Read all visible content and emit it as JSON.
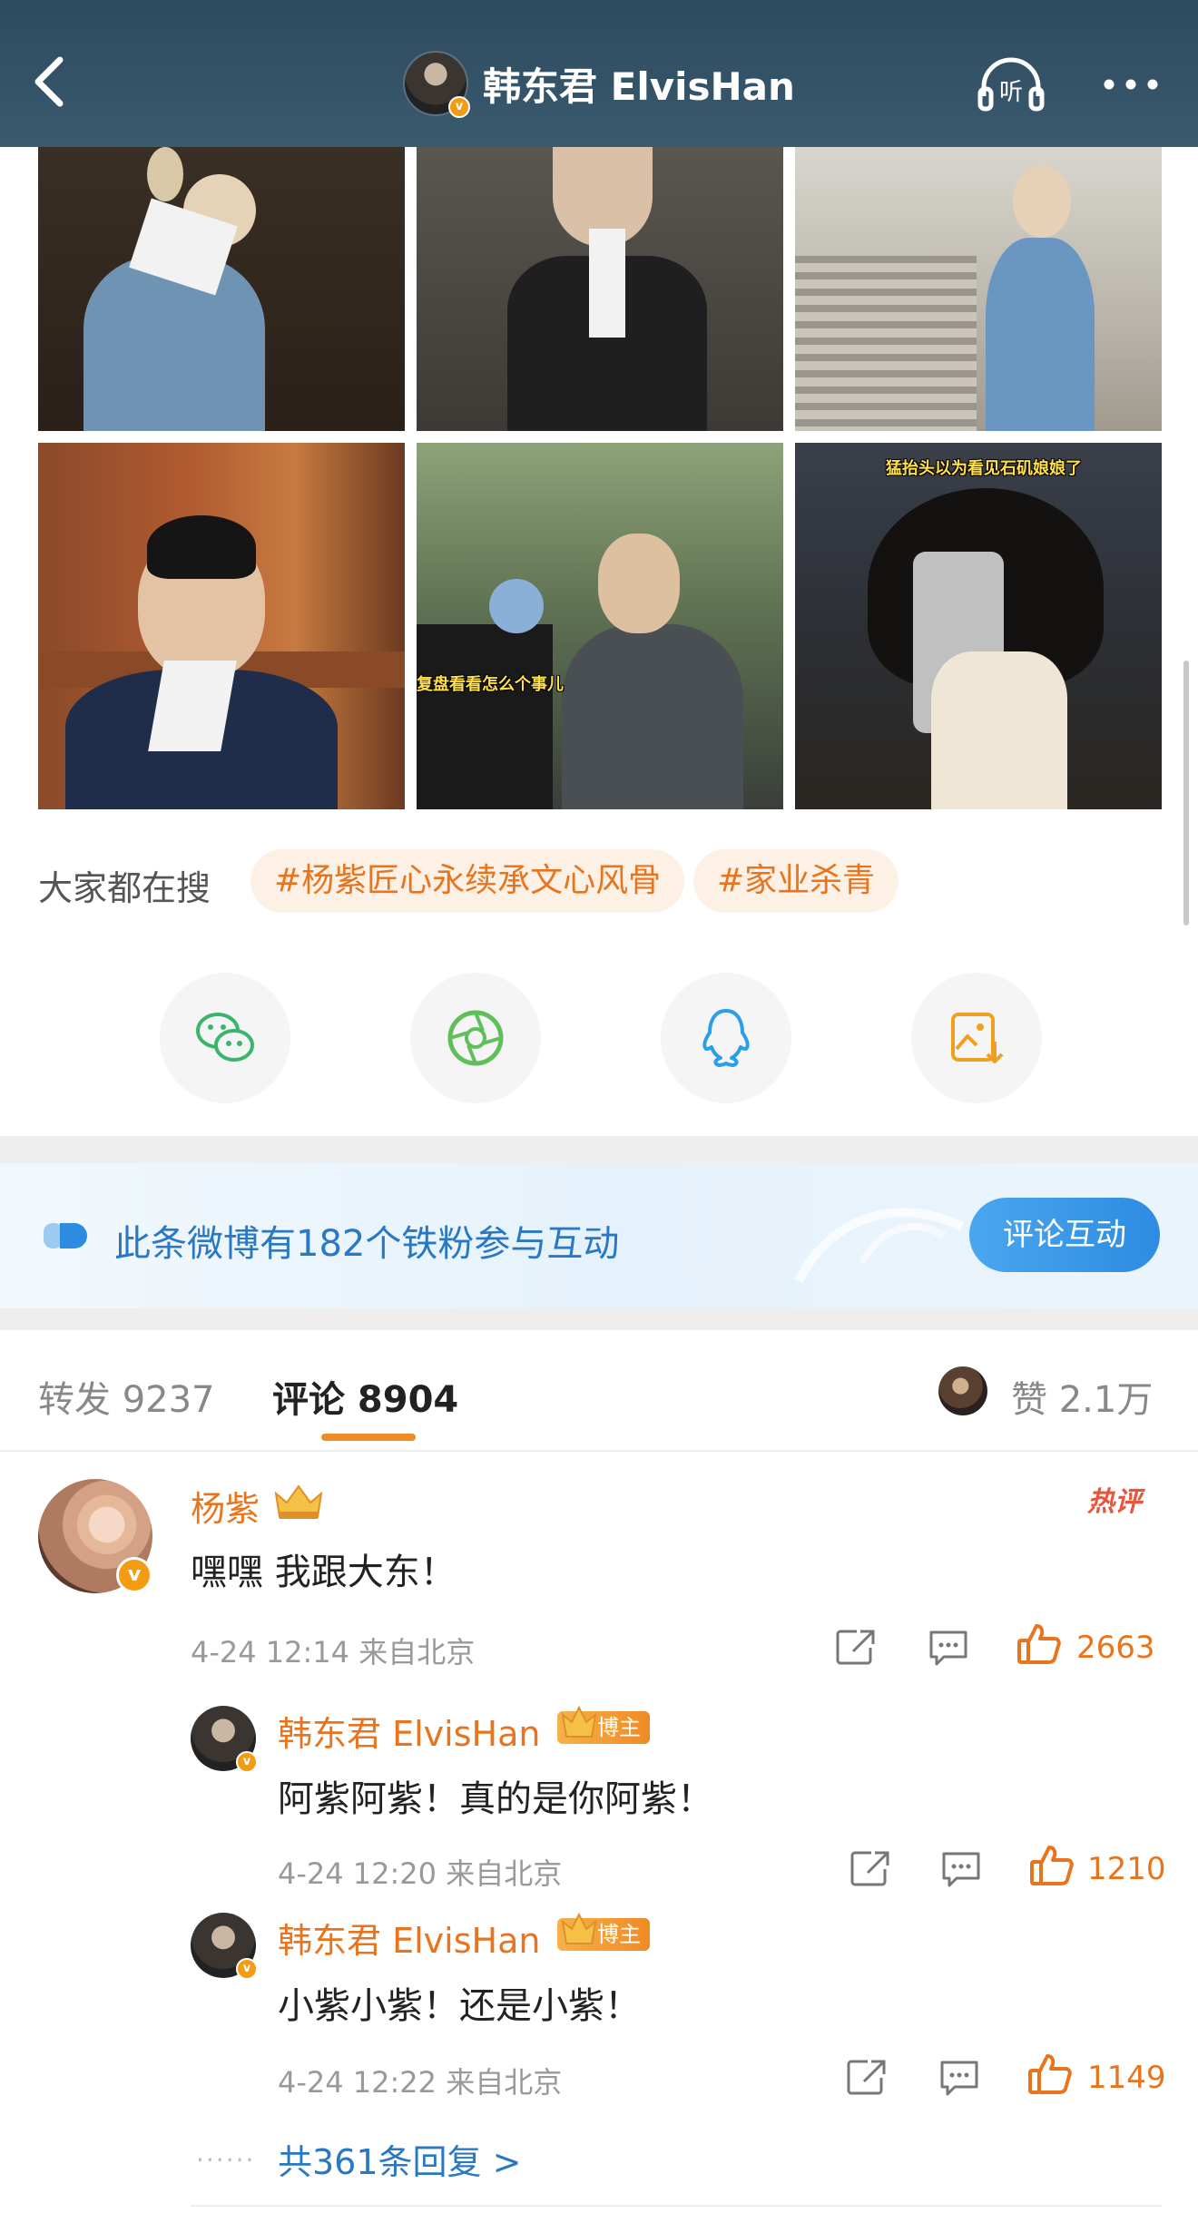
{
  "header": {
    "title": "韩东君 ElvisHan",
    "verified_mark": "v",
    "listen_label": "听"
  },
  "photos": {
    "caption_5": "复盘看看怎么个事儿",
    "caption_6": "猛抬头以为看见石矶娘娘了"
  },
  "search": {
    "label": "大家都在搜",
    "tags": [
      "#杨紫匠心永续承文心风骨",
      "#家业杀青"
    ]
  },
  "share": {
    "icons": [
      "wechat-icon",
      "moments-icon",
      "qq-icon",
      "save-image-icon"
    ]
  },
  "fan_banner": {
    "text": "此条微博有182个铁粉参与互动",
    "button": "评论互动"
  },
  "tabs": {
    "repost": "转发 9237",
    "comment": "评论 8904",
    "like": "赞 2.1万"
  },
  "comments": [
    {
      "name": "杨紫",
      "text": "嘿嘿 我跟大东！",
      "meta": "4-24 12:14  来自北京",
      "likes": "2663",
      "hot": "热评"
    }
  ],
  "replies": [
    {
      "name": "韩东君 ElvisHan",
      "badge": "博主",
      "text": "阿紫阿紫！真的是你阿紫！",
      "meta": "4-24 12:20  来自北京",
      "likes": "1210"
    },
    {
      "name": "韩东君 ElvisHan",
      "badge": "博主",
      "text": "小紫小紫！还是小紫！",
      "meta": "4-24 12:22  来自北京",
      "likes": "1149"
    }
  ],
  "more_replies": "共361条回复 >",
  "colors": {
    "header_bg": "#2e4a5f",
    "accent_orange": "#e8741e",
    "link_blue": "#2a78c4"
  }
}
